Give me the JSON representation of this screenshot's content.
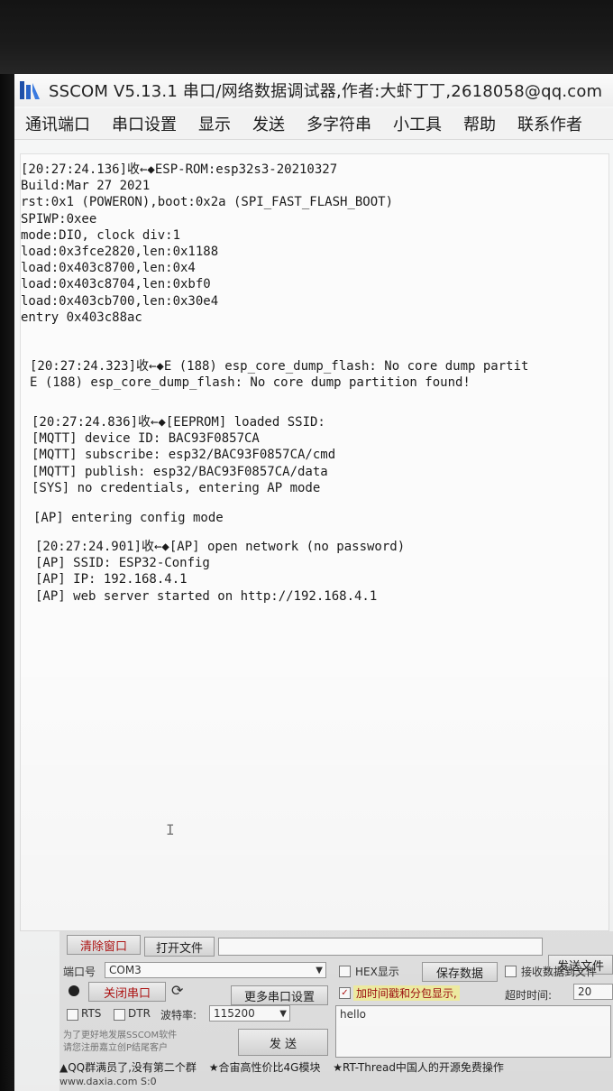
{
  "window": {
    "title": "SSCOM V5.13.1 串口/网络数据调试器,作者:大虾丁丁,2618058@qq.com"
  },
  "menu": {
    "items": [
      "通讯端口",
      "串口设置",
      "显示",
      "发送",
      "多字符串",
      "小工具",
      "帮助",
      "联系作者"
    ]
  },
  "terminal": {
    "blocks": [
      [
        "[20:27:24.136]收←◆ESP-ROM:esp32s3-20210327",
        "Build:Mar 27 2021",
        "rst:0x1 (POWERON),boot:0x2a (SPI_FAST_FLASH_BOOT)",
        "SPIWP:0xee",
        "mode:DIO, clock div:1",
        "load:0x3fce2820,len:0x1188",
        "load:0x403c8700,len:0x4",
        "load:0x403c8704,len:0xbf0",
        "load:0x403cb700,len:0x30e4",
        "entry 0x403c88ac"
      ],
      [
        "[20:27:24.323]收←◆E (188) esp_core_dump_flash: No core dump partit",
        "E (188) esp_core_dump_flash: No core dump partition found!"
      ],
      [
        "[20:27:24.836]收←◆[EEPROM] loaded SSID:",
        "[MQTT] device ID: BAC93F0857CA",
        "[MQTT] subscribe: esp32/BAC93F0857CA/cmd",
        "[MQTT] publish: esp32/BAC93F0857CA/data",
        "[SYS] no credentials, entering AP mode"
      ],
      [
        "[AP] entering config mode"
      ],
      [
        "[20:27:24.901]收←◆[AP] open network (no password)",
        "[AP] SSID: ESP32-Config",
        "[AP] IP: 192.168.4.1",
        "[AP] web server started on http://192.168.4.1"
      ]
    ]
  },
  "controls": {
    "clear_window": "清除窗口",
    "open_file": "打开文件",
    "send_file": "发送文件",
    "port_label": "端口号",
    "port_value": "COM3",
    "close_port": "关闭串口",
    "more_settings": "更多串口设置",
    "rts": "RTS",
    "dtr": "DTR",
    "baud_label": "波特率:",
    "baud_value": "115200",
    "hex_display": "HEX显示",
    "save_data": "保存数据",
    "receive_to_file": "接收数据到文件",
    "timestamp_split": "加时间戳和分包显示,",
    "timeout_label": "超时时间:",
    "timeout_value": "20",
    "send_text": "hello",
    "send_button": "发 送",
    "tip_line1": "为了更好地发展SSCOM软件",
    "tip_line2": "请您注册嘉立创P结尾客户"
  },
  "status": {
    "items": [
      "▲QQ群满员了,没有第二个群",
      "★合宙高性价比4G模块",
      "★RT-Thread中国人的开源免费操作"
    ]
  },
  "footer": {
    "text": "www.daxia.com  S:0"
  },
  "colors": {
    "accent_red": "#b11414",
    "highlight_yellow": "#f3f0a4"
  }
}
